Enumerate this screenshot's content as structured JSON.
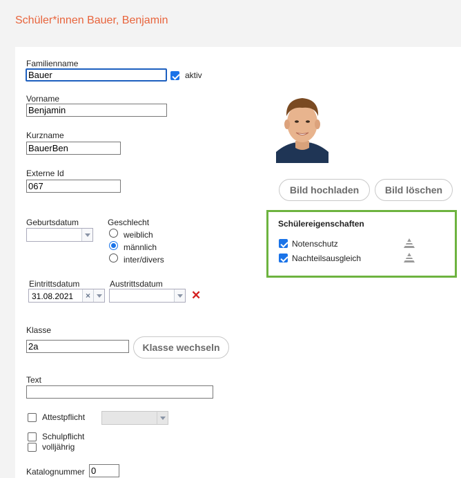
{
  "page": {
    "title": "Schüler*innen Bauer, Benjamin"
  },
  "form": {
    "familienname": {
      "label": "Familienname",
      "value": "Bauer"
    },
    "aktiv": {
      "label": "aktiv",
      "checked": true
    },
    "vorname": {
      "label": "Vorname",
      "value": "Benjamin"
    },
    "kurzname": {
      "label": "Kurzname",
      "value": "BauerBen"
    },
    "externe_id": {
      "label": "Externe Id",
      "value": "067"
    },
    "geburtsdatum": {
      "label": "Geburtsdatum",
      "value": ""
    },
    "geschlecht": {
      "label": "Geschlecht",
      "options": [
        "weiblich",
        "männlich",
        "inter/divers"
      ],
      "selected": "männlich"
    },
    "eintrittsdatum": {
      "label": "Eintrittsdatum",
      "value": "31.08.2021"
    },
    "austrittsdatum": {
      "label": "Austrittsdatum",
      "value": ""
    },
    "klasse": {
      "label": "Klasse",
      "value": "2a",
      "button": "Klasse wechseln"
    },
    "text": {
      "label": "Text",
      "value": ""
    },
    "attestpflicht": {
      "label": "Attestpflicht",
      "checked": false,
      "select_value": ""
    },
    "schulpflicht": {
      "label": "Schulpflicht",
      "checked": false
    },
    "volljaehrig": {
      "label": "volljährig",
      "checked": false
    },
    "katalognummer": {
      "label": "Katalognummer",
      "value": "0"
    }
  },
  "photo": {
    "upload_button": "Bild hochladen",
    "delete_button": "Bild löschen"
  },
  "eigenschaften": {
    "title": "Schülereigenschaften",
    "items": [
      {
        "label": "Notenschutz",
        "checked": true,
        "icon": "triangle-icon"
      },
      {
        "label": "Nachteilsausgleich",
        "checked": true,
        "icon": "triangle-icon"
      }
    ]
  },
  "colors": {
    "title": "#e8643c",
    "accent": "#1a73e8",
    "panel_border": "#6db33f",
    "delete": "#d42020"
  }
}
